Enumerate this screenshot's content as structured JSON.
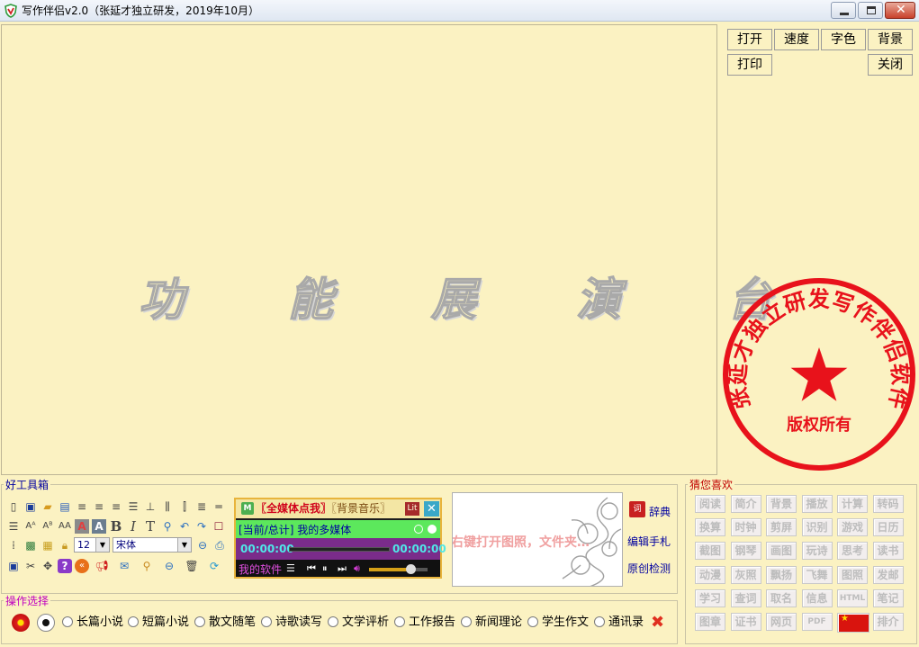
{
  "window": {
    "title": "写作伴侣v2.0（张延才独立研发，2019年10月）"
  },
  "editor": {
    "demo_chars": [
      "功",
      "能",
      "展",
      "演",
      "台"
    ]
  },
  "right_panel": {
    "buttons": {
      "open": "打开",
      "speed": "速度",
      "font_color": "字色",
      "background": "背景",
      "print": "打印",
      "close": "关闭"
    },
    "seal": {
      "ring_text": "张延才独立研发写作伴侣软件",
      "center_text": "版权所有",
      "color": "#e8121b"
    }
  },
  "toolbox": {
    "title": "好工具箱",
    "font_size": "12",
    "font_name": "宋体",
    "icons_row1": [
      "new-doc-icon",
      "save-icon",
      "open-folder-icon",
      "list-icon",
      "align-left-icon",
      "align-center-icon",
      "align-right-icon",
      "justify-icon",
      "align-bottom-icon",
      "columns-icon",
      "indent-icon",
      "line-spacing-icon"
    ],
    "icons_row2": [
      "lines-icon",
      "superscript-icon",
      "subscript-icon",
      "font-case-icon",
      "color-a-icon",
      "fill-a-icon",
      "bold-icon",
      "italic-icon",
      "text-t-icon",
      "find-icon",
      "undo-icon",
      "redo-icon",
      "border-icon"
    ],
    "icons_row3": [
      "save-disk-icon",
      "cut-icon",
      "move-icon",
      "help-icon",
      "back-icon",
      "megaphone-icon",
      "mail-icon",
      "search-icon",
      "minus-icon",
      "trash-icon",
      "refresh-icon"
    ]
  },
  "player": {
    "header_a": "〖全媒体点我〗",
    "header_b": "〖背景音乐〗",
    "lit_label": "Lit",
    "track": "[当前/总计] 我的多媒体",
    "time_current": "00:00:00",
    "time_total": "00:00:00",
    "my_software": "我的软件",
    "volume": 0.7
  },
  "image_box": {
    "hint": "右键打开图照，文件夹…"
  },
  "side_links": {
    "dictionary": "辞典",
    "edit_notes": "编辑手札",
    "original_check": "原创检测"
  },
  "guess": {
    "title": "猜您喜欢",
    "rows": [
      [
        "阅读",
        "简介",
        "背景",
        "播放",
        "计算",
        "转码"
      ],
      [
        "换算",
        "时钟",
        "剪屏",
        "识别",
        "游戏",
        "日历"
      ],
      [
        "截图",
        "钢琴",
        "画图",
        "玩诗",
        "思考",
        "读书"
      ],
      [
        "动漫",
        "灰照",
        "飘扬",
        "飞舞",
        "图照",
        "发邮"
      ],
      [
        "学习",
        "查词",
        "取名",
        "信息",
        "HTML",
        "笔记"
      ],
      [
        "图章",
        "证书",
        "网页",
        "PDF",
        "",
        "排介"
      ]
    ]
  },
  "operation": {
    "title": "操作选择",
    "options": [
      "长篇小说",
      "短篇小说",
      "散文随笔",
      "诗歌读写",
      "文学评析",
      "工作报告",
      "新闻理论",
      "学生作文",
      "通讯录"
    ],
    "selected_index": -1
  }
}
